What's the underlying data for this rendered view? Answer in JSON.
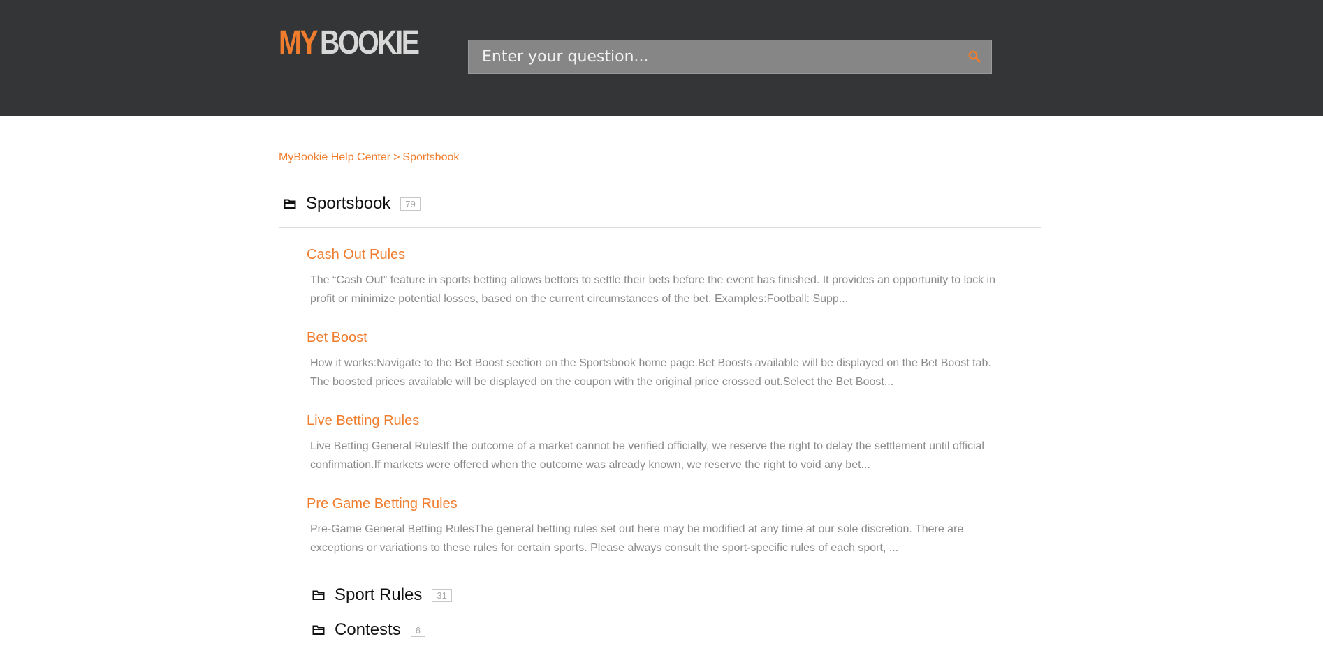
{
  "header": {
    "logo_part1": "MY",
    "logo_part2": "BOOKIE",
    "search_placeholder": "Enter your question...",
    "search_icon": "search-icon"
  },
  "breadcrumb": {
    "home": "MyBookie Help Center",
    "separator": ">",
    "current": "Sportsbook"
  },
  "section": {
    "title": "Sportsbook",
    "count": "79",
    "icon": "folder-icon"
  },
  "articles": [
    {
      "title": "Cash Out Rules",
      "excerpt": "The “Cash Out” feature in sports betting allows bettors to settle their bets before the event has finished. It provides an opportunity to lock in profit or minimize potential losses, based on the current circumstances of the bet. Examples:Football: Supp..."
    },
    {
      "title": "Bet Boost",
      "excerpt": "How it works:Navigate to the Bet Boost section on the Sportsbook home page.Bet Boosts available will be displayed on the Bet Boost tab. The boosted prices available will be displayed on the coupon with the original price crossed out.Select the Bet Boost..."
    },
    {
      "title": "Live Betting Rules",
      "excerpt": "Live Betting General RulesIf the outcome of a market cannot be verified officially, we reserve the right to delay the settlement until official confirmation.If markets were offered when the outcome was already known, we reserve the right to void any bet..."
    },
    {
      "title": "Pre Game Betting Rules",
      "excerpt": "Pre-Game General Betting RulesThe general betting rules set out here may be modified at any time at our sole discretion. There are exceptions or variations to these rules for certain sports. Please always consult the sport-specific rules of each sport, ..."
    }
  ],
  "subcategories": [
    {
      "title": "Sport Rules",
      "count": "31"
    },
    {
      "title": "Contests",
      "count": "6"
    }
  ],
  "colors": {
    "header_bg": "#343537",
    "accent": "#f07d2e",
    "search_bg": "#868686",
    "excerpt_text": "#8a8a8a"
  }
}
